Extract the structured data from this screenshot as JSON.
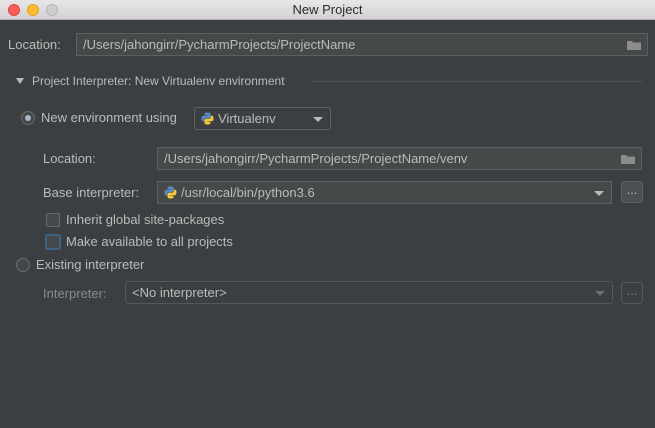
{
  "window": {
    "title": "New Project"
  },
  "project": {
    "location_label": "Location:",
    "location_value": "/Users/jahongirr/PycharmProjects/ProjectName"
  },
  "interpreter_section": {
    "title": "Project Interpreter: New Virtualenv environment",
    "expanded": true
  },
  "new_env": {
    "radio_label": "New environment using",
    "selected": true,
    "tool_value": "Virtualenv",
    "location_label": "Location:",
    "location_value": "/Users/jahongirr/PycharmProjects/ProjectName/venv",
    "base_interpreter_label": "Base interpreter:",
    "base_interpreter_value": "/usr/local/bin/python3.6",
    "browse_label": "...",
    "inherit_label": "Inherit global site-packages",
    "inherit_checked": false,
    "make_available_label": "Make available to all projects",
    "make_available_checked": false
  },
  "existing": {
    "radio_label": "Existing interpreter",
    "selected": false,
    "interpreter_label": "Interpreter:",
    "interpreter_value": "<No interpreter>",
    "browse_label": "..."
  }
}
